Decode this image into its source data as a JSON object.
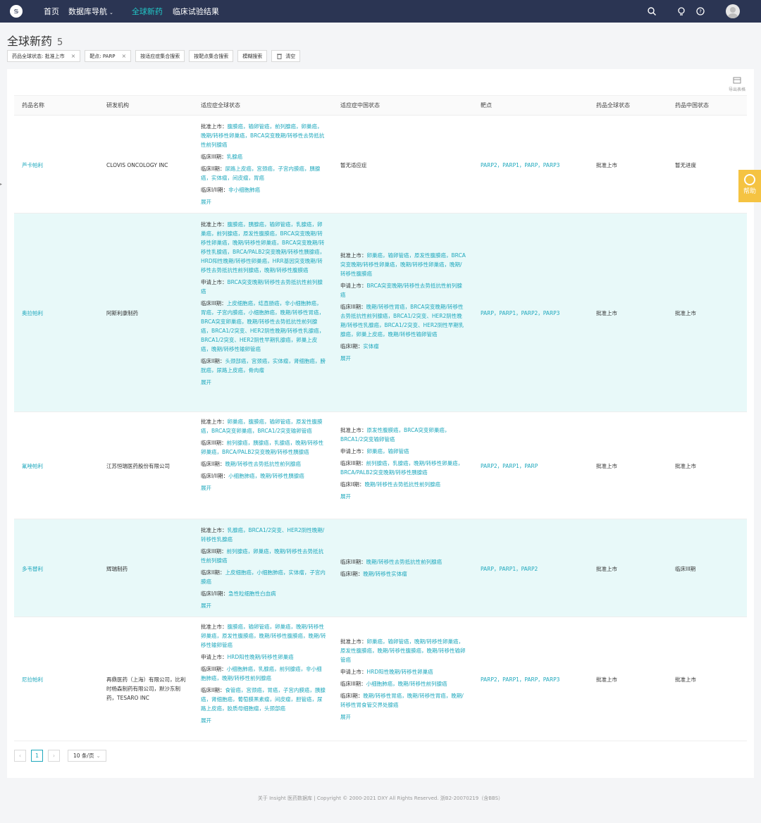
{
  "topbar": {
    "logo": "𝕤",
    "nav": [
      {
        "label": "首页"
      },
      {
        "label": "数据库导航",
        "caret": "⌄"
      },
      {
        "label": "全球新药"
      },
      {
        "label": "临床试验结果"
      }
    ]
  },
  "page": {
    "title": "全球新药",
    "count": "5"
  },
  "filters": [
    {
      "label": "药品全球状态: 批准上市",
      "close": "×"
    },
    {
      "label": "靶点: PARP",
      "close": "×"
    },
    {
      "label": "按适应症集合搜索"
    },
    {
      "label": "按靶点集合搜索"
    },
    {
      "label": "模糊搜索"
    },
    {
      "label": "清空"
    }
  ],
  "export_label": "导出表格",
  "table": {
    "columns": [
      "药品名称",
      "研发机构",
      "适应症全球状态",
      "适应症中国状态",
      "靶点",
      "药品全球状态",
      "药品中国状态"
    ],
    "rows": [
      {
        "name": "芦卡帕利",
        "org": "CLOVIS ONCOLOGY INC",
        "global": [
          {
            "label": "批准上市：",
            "value": "腹膜癌，输卵管癌，前列腺癌，卵巢癌，晚期/转移性卵巢癌，BRCA突变晚期/转移性去势抵抗性前列腺癌"
          },
          {
            "label": "临床III期：",
            "value": "乳腺癌"
          },
          {
            "label": "临床II期：",
            "value": "尿路上皮癌，宫颈癌，子宫内膜癌，胰腺癌，实体瘤，间皮瘤，胃癌"
          },
          {
            "label": "临床I/II期：",
            "value": "非小细胞肺癌"
          }
        ],
        "global_more": "展开",
        "china_plain": "暂无适应症",
        "china": [],
        "targets": "PARP2，PARP1，PARP，PARP3",
        "global_status": "批准上市",
        "china_status": "暂无进度"
      },
      {
        "name": "奥拉帕利",
        "org": "阿斯利康制药",
        "global": [
          {
            "label": "批准上市：",
            "value": "腹膜癌，胰腺癌，输卵管癌，乳腺癌，卵巢癌，前列腺癌，原发性腹膜癌，BRCA突变晚期/转移性卵巢癌，晚期/转移性卵巢癌，BRCA突变晚期/转移性乳腺癌，BRCA/PALB2突变晚期/转移性胰腺癌，HRD阳性晚期/转移性卵巢癌，HRR基因突变晚期/转移性去势抵抗性前列腺癌，晚期/转移性腹膜癌"
          },
          {
            "label": "申请上市：",
            "value": "BRCA突变晚期/转移性去势抵抗性前列腺癌"
          },
          {
            "label": "临床III期：",
            "value": "上皮细胞癌，结直肠癌，非小细胞肺癌，胃癌，子宫内膜癌，小细胞肺癌，晚期/转移性胃癌，BRCA突变卵巢癌，晚期/转移性去势抵抗性前列腺癌，BRCA1/2突变、HER2阴性晚期/转移性乳腺癌，BRCA1/2突变、HER2阴性早期乳腺癌，卵巢上皮癌，晚期/转移性输卵管癌"
          },
          {
            "label": "临床II期：",
            "value": "头颈部癌，宫颈癌，实体瘤，肾细胞癌，膀胱癌，尿路上皮癌，骨肉瘤"
          }
        ],
        "global_more": "展开",
        "china_plain": "",
        "china": [
          {
            "label": "批准上市：",
            "value": "卵巢癌，输卵管癌，原发性腹膜癌，BRCA突变晚期/转移性卵巢癌，晚期/转移性卵巢癌，晚期/转移性腹膜癌"
          },
          {
            "label": "申请上市：",
            "value": "BRCA突变晚期/转移性去势抵抗性前列腺癌"
          },
          {
            "label": "临床III期：",
            "value": "晚期/转移性胃癌，BRCA突变晚期/转移性去势抵抗性前列腺癌，BRCA1/2突变、HER2阴性晚期/转移性乳腺癌，BRCA1/2突变、HER2阴性早期乳腺癌，卵巢上皮癌，晚期/转移性输卵管癌"
          },
          {
            "label": "临床I期：",
            "value": "实体瘤"
          }
        ],
        "china_more": "展开",
        "targets": "PARP，PARP1，PARP2，PARP3",
        "global_status": "批准上市",
        "china_status": "批准上市"
      },
      {
        "name": "氟唑帕利",
        "org": "江苏恒瑞医药股份有限公司",
        "global": [
          {
            "label": "批准上市：",
            "value": "卵巢癌，腹膜癌，输卵管癌，原发性腹膜癌，BRCA突变卵巢癌，BRCA1/2突变输卵管癌"
          },
          {
            "label": "临床III期：",
            "value": "前列腺癌，胰腺癌，乳腺癌，晚期/转移性卵巢癌，BRCA/PALB2突变晚期/转移性胰腺癌"
          },
          {
            "label": "临床II期：",
            "value": "晚期/转移性去势抵抗性前列腺癌"
          },
          {
            "label": "临床I/II期：",
            "value": "小细胞肺癌，晚期/转移性胰腺癌"
          }
        ],
        "global_more": "展开",
        "china_plain": "",
        "china": [
          {
            "label": "批准上市：",
            "value": "原发性腹膜癌，BRCA突变卵巢癌，BRCA1/2突变输卵管癌"
          },
          {
            "label": "申请上市：",
            "value": "卵巢癌，输卵管癌"
          },
          {
            "label": "临床III期：",
            "value": "前列腺癌，乳腺癌，晚期/转移性卵巢癌，BRCA/PALB2突变晚期/转移性胰腺癌"
          },
          {
            "label": "临床II期：",
            "value": "晚期/转移性去势抵抗性前列腺癌"
          }
        ],
        "china_more": "展开",
        "targets": "PARP2，PARP1，PARP",
        "global_status": "批准上市",
        "china_status": "批准上市"
      },
      {
        "name": "多韦替利",
        "org": "辉瑞制药",
        "global": [
          {
            "label": "批准上市：",
            "value": "乳腺癌，BRCA1/2突变、HER2阴性晚期/转移性乳腺癌"
          },
          {
            "label": "临床III期：",
            "value": "前列腺癌，卵巢癌，晚期/转移性去势抵抗性前列腺癌"
          },
          {
            "label": "临床II期：",
            "value": "上皮细胞癌，小细胞肺癌，实体瘤，子宫内膜癌"
          },
          {
            "label": "临床I/II期：",
            "value": "急性粒细胞性白血病"
          }
        ],
        "global_more": "展开",
        "china_plain": "",
        "china": [
          {
            "label": "临床III期：",
            "value": "晚期/转移性去势抵抗性前列腺癌"
          },
          {
            "label": "临床I期：",
            "value": "晚期/转移性实体瘤"
          }
        ],
        "china_more": "",
        "targets": "PARP，PARP1，PARP2",
        "global_status": "批准上市",
        "china_status": "临床III期"
      },
      {
        "name": "尼拉帕利",
        "org": "再鼎医药（上海）有限公司，比利时杨森制药有限公司，默沙东制药，TESARO INC",
        "global": [
          {
            "label": "批准上市：",
            "value": "腹膜癌，输卵管癌，卵巢癌，晚期/转移性卵巢癌，原发性腹膜癌，晚期/转移性腹膜癌，晚期/转移性输卵管癌"
          },
          {
            "label": "申请上市：",
            "value": "HRD阳性晚期/转移性卵巢癌"
          },
          {
            "label": "临床III期：",
            "value": "小细胞肺癌，乳腺癌，前列腺癌，非小细胞肺癌，晚期/转移性前列腺癌"
          },
          {
            "label": "临床II期：",
            "value": "食管癌，宫颈癌，胃癌，子宫内膜癌，胰腺癌，肾细胞癌，葡萄膜黑素瘤，间皮瘤，胆管癌，尿路上皮癌，胶质母细胞瘤，头颈部癌"
          }
        ],
        "global_more": "展开",
        "china_plain": "",
        "china": [
          {
            "label": "批准上市：",
            "value": "卵巢癌，输卵管癌，晚期/转移性卵巢癌，原发性腹膜癌，晚期/转移性腹膜癌，晚期/转移性输卵管癌"
          },
          {
            "label": "申请上市：",
            "value": "HRD阳性晚期/转移性卵巢癌"
          },
          {
            "label": "临床III期：",
            "value": "小细胞肺癌，晚期/转移性前列腺癌"
          },
          {
            "label": "临床I期：",
            "value": "晚期/转移性胃癌，晚期/转移性胃癌，晚期/转移性胃食管交界处腺癌"
          }
        ],
        "china_more": "展开",
        "targets": "PARP2，PARP1，PARP，PARP3",
        "global_status": "批准上市",
        "china_status": "批准上市"
      }
    ]
  },
  "pagination": {
    "prev": "‹",
    "page": "1",
    "next": "›",
    "size": "10 条/页",
    "size_caret": "⌄"
  },
  "footer": "关于 Insight 医药数据库 | Copyright © 2000-2021 DXY All Rights Reserved. 浙B2-20070219（含BBS）",
  "help_label": "帮助",
  "side_caret": "▸"
}
